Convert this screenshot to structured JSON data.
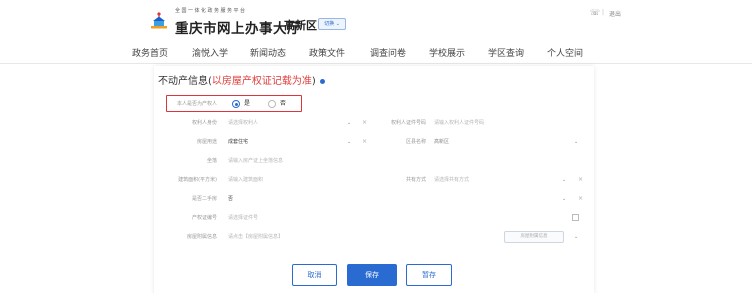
{
  "header": {
    "brand_sub": "全国一体化政务服务平台",
    "brand": "重庆市网上办事大厅",
    "district": "高新区",
    "district_switch": "切换 ⌄",
    "top_icon": "☏",
    "top_sep": "|",
    "logout": "退出"
  },
  "nav": {
    "items": [
      "政务首页",
      "渝悦入学",
      "新闻动态",
      "政策文件",
      "调查问卷",
      "学校展示",
      "学区查询",
      "个人空间"
    ]
  },
  "section": {
    "title_prefix": "不动产信息(",
    "title_highlight": "以房屋产权证记载为准",
    "title_suffix": ")"
  },
  "form": {
    "is_owner": {
      "label": "本人是否为产权人",
      "opt_yes": "是",
      "opt_no": "否",
      "selected": "是"
    },
    "owner_identity": {
      "label": "权利人身份",
      "placeholder": "请选择权利人",
      "idcard_label": "权利人证件号码",
      "idcard_placeholder": "请输入权利人证件号码"
    },
    "house_use": {
      "label": "房屋用途",
      "value": "成套住宅",
      "region_label": "区县名称",
      "region_value": "高新区"
    },
    "address": {
      "label": "坐落",
      "placeholder": "请输入房产证上坐落信息"
    },
    "area": {
      "label": "建筑面积(平方米)",
      "placeholder": "请输入建筑面积",
      "ownership_label": "共有方式",
      "ownership_placeholder": "请选择共有方式"
    },
    "second_hand": {
      "label": "是否二手房",
      "value": "否"
    },
    "cert_no": {
      "label": "产权证编号",
      "placeholder": "请选择证件号"
    },
    "attachment": {
      "label": "房屋附属信息",
      "placeholder": "请点击【房屋附属信息】",
      "button": "房屋附属信息"
    },
    "arrow": "⌄",
    "clear": "×"
  },
  "buttons": {
    "cancel": "取消",
    "save": "保存",
    "stash": "暂存"
  },
  "colors": {
    "accent": "#2a6bd1",
    "highlight_red": "#e23b3b",
    "box_red": "#d9363e"
  }
}
